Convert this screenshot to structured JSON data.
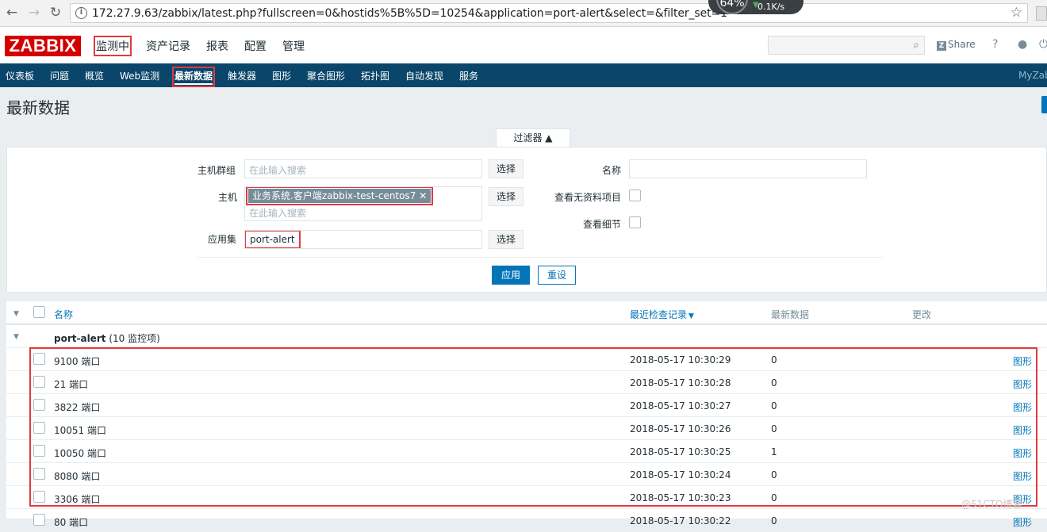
{
  "browser": {
    "url": "172.27.9.63/zabbix/latest.php?fullscreen=0&hostids%5B%5D=10254&application=port-alert&select=&filter_set=1",
    "speed_percent": "64%",
    "speed_value": "0.1K/s"
  },
  "header": {
    "logo": "ZABBIX",
    "nav": [
      "监测中",
      "资产记录",
      "报表",
      "配置",
      "管理"
    ],
    "share": "Share",
    "help": "?",
    "search_placeholder": ""
  },
  "subnav": {
    "items": [
      "仪表板",
      "问题",
      "概览",
      "Web监测",
      "最新数据",
      "触发器",
      "图形",
      "聚合图形",
      "拓扑图",
      "自动发现",
      "服务"
    ],
    "active": "最新数据",
    "right_text": "MyZab"
  },
  "page": {
    "title": "最新数据"
  },
  "filter": {
    "tab_label": "过滤器 ▲",
    "host_group_label": "主机群组",
    "host_group_placeholder": "在此输入搜索",
    "host_label": "主机",
    "host_chip": "业务系统.客户端zabbix-test-centos7",
    "host_placeholder": "在此输入搜索",
    "application_label": "应用集",
    "application_value": "port-alert",
    "select_label": "选择",
    "name_label": "名称",
    "name_value": "",
    "show_without_data_label": "查看无资料项目",
    "show_details_label": "查看细节",
    "apply_label": "应用",
    "reset_label": "重设"
  },
  "table": {
    "headers": {
      "name": "名称",
      "last_check": "最近检查记录",
      "last_value": "最新数据",
      "change": "更改"
    },
    "group": {
      "name": "port-alert",
      "count": "(10 监控项)"
    },
    "graph_label": "图形",
    "rows": [
      {
        "name": "9100 端口",
        "last_check": "2018-05-17 10:30:29",
        "value": "0"
      },
      {
        "name": "21 端口",
        "last_check": "2018-05-17 10:30:28",
        "value": "0"
      },
      {
        "name": "3822 端口",
        "last_check": "2018-05-17 10:30:27",
        "value": "0"
      },
      {
        "name": "10051 端口",
        "last_check": "2018-05-17 10:30:26",
        "value": "0"
      },
      {
        "name": "10050 端口",
        "last_check": "2018-05-17 10:30:25",
        "value": "1"
      },
      {
        "name": "8080 端口",
        "last_check": "2018-05-17 10:30:24",
        "value": "0"
      },
      {
        "name": "3306 端口",
        "last_check": "2018-05-17 10:30:23",
        "value": "0"
      },
      {
        "name": "80 端口",
        "last_check": "2018-05-17 10:30:22",
        "value": "0"
      }
    ]
  },
  "watermark": "@51CTO博客"
}
